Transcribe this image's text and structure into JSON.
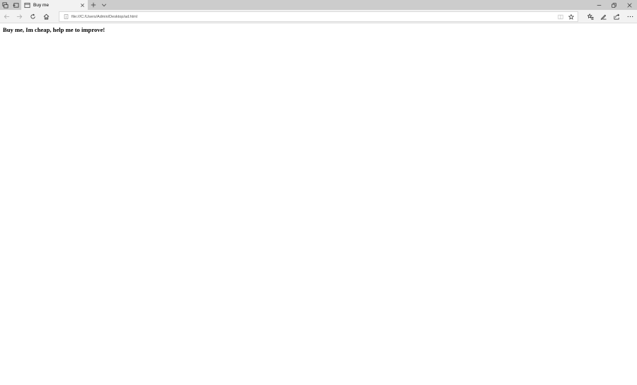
{
  "browser": {
    "tab": {
      "title": "Buy me"
    },
    "address": {
      "url": "file:///C:/Users/Admin/Desktop/ad.html"
    },
    "icons": {
      "tab_actions": "tab-actions-icon",
      "back_tabs": "set-aside-tabs-icon",
      "tab_favicon": "page-icon",
      "tab_close": "close-icon",
      "new_tab": "plus-icon",
      "tab_list": "chevron-down-icon",
      "minimize": "minimize-icon",
      "maximize": "restore-icon",
      "close": "close-icon",
      "back": "back-arrow-icon",
      "forward": "forward-arrow-icon",
      "refresh": "refresh-icon",
      "home": "home-icon",
      "info": "info-icon",
      "reading_view": "reading-view-icon",
      "favorite": "star-icon",
      "favorites_hub": "favorites-hub-icon",
      "web_notes": "pen-icon",
      "share": "share-icon",
      "more": "more-icon"
    }
  },
  "page": {
    "headline": "Buy me, Im cheap, help me to improve!"
  }
}
